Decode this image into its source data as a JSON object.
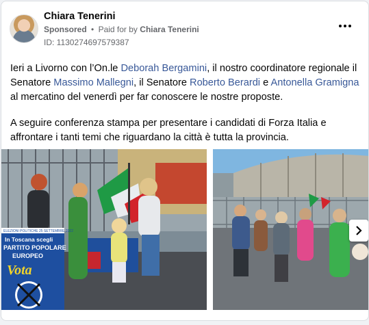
{
  "post": {
    "author": "Chiara Tenerini",
    "sponsored_label": "Sponsored",
    "separator": "•",
    "paid_for_label": "Paid for by",
    "payer": "Chiara Tenerini",
    "ad_id": "ID: 1130274697579387",
    "more_icon": "more-horizontal-icon",
    "body": {
      "p1": {
        "t1": "Ieri a Livorno con l’On.le ",
        "link1": "Deborah Bergamini",
        "t2": ", il nostro coordinatore regionale il Senatore ",
        "link2": "Massimo Mallegni",
        "t3": ", il Senatore ",
        "link3": "Roberto Berardi",
        "t4": " e ",
        "link4": "Antonella Gramigna",
        "t5": " al mercatino del venerdì per far conoscere le nostre proposte."
      },
      "p2": "A seguire conferenza stampa per presentare i candidati di Forza Italia e affrontare i tanti temi che riguardano la città è tutta la provincia."
    },
    "images": {
      "photo1": {
        "banner_top": "In Toscana scegli",
        "banner_line1": "PARTITO POPOLARE",
        "banner_line2": "EUROPEO",
        "banner_vota": "Vota",
        "banner_small": "ELEZIONI POLITICHE 25 SETTEMBRE 2022"
      }
    },
    "next_icon": "chevron-right-icon",
    "colors": {
      "link": "#385898",
      "meta": "#65676b",
      "background": "#f0f2f5"
    }
  }
}
